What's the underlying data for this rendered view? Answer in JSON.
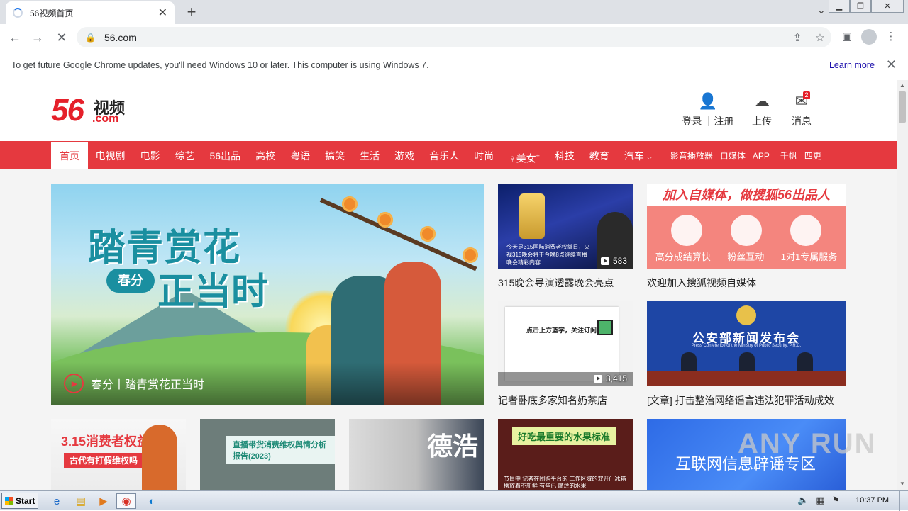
{
  "browser": {
    "tab_title": "56视频首页",
    "url": "56.com",
    "infobar_message": "To get future Google Chrome updates, you'll need Windows 10 or later. This computer is using Windows 7.",
    "infobar_link": "Learn more"
  },
  "header": {
    "logo_num": "56",
    "logo_cn": "视频",
    "logo_domain": ".com",
    "login": "登录",
    "register": "注册",
    "upload": "上传",
    "messages": "消息",
    "message_badge": "2"
  },
  "nav": {
    "items": [
      "首页",
      "电视剧",
      "电影",
      "综艺",
      "56出品",
      "高校",
      "粤语",
      "搞笑",
      "生活",
      "游戏",
      "音乐人",
      "时尚",
      "美女",
      "科技",
      "教育",
      "汽车"
    ],
    "beauty_sup": "+",
    "car_arrow": "⌵",
    "right_items": [
      "影音播放器",
      "自媒体",
      "APP",
      "千帆",
      "四更"
    ]
  },
  "hero": {
    "title_line1": "踏青赏花",
    "title_line2": "正当时",
    "pill": "春分",
    "caption": "春分丨踏青赏花正当时"
  },
  "cards": {
    "c1": {
      "title": "315晚会导演透露晚会亮点",
      "count": "583",
      "overlay": "今天是315国际消费者权益日，央视315晚会将于今晚8点继续直播晚会精彩内容"
    },
    "c2": {
      "title": "欢迎加入搜狐视频自媒体",
      "banner": "加入自媒体，做搜狐56出品人",
      "labels": [
        "高分成结算快",
        "粉丝互动",
        "1对1专属服务"
      ]
    },
    "c3": {
      "title": "记者卧底多家知名奶茶店",
      "count": "3,415",
      "headline": "点击上方蓝字，关注订阅我们"
    },
    "c4": {
      "title": "[文章] 打击整治网络谣言违法犯罪活动成效",
      "banner": "公安部新闻发布会",
      "sub": "Press Conference of the Ministry of Public Security, P.R.C."
    }
  },
  "row3": {
    "r1_big": "3.15消费者权益日",
    "r1_sub": "古代有打假维权吗",
    "r2_banner": "直播带货消费维权舆情分析报告(2023)",
    "r3_char": "德浩",
    "r4_banner": "好吃最重要的水果标准",
    "r4_caption": "节目中 记者在团购平台的 工作区域的双开门冰箱 摆放着不新鲜 有些已 腐烂的水果",
    "r5_text": "互联网信息辟谣专区"
  },
  "watermark": "ANY RUN",
  "taskbar": {
    "start": "Start",
    "clock": "10:37 PM"
  }
}
